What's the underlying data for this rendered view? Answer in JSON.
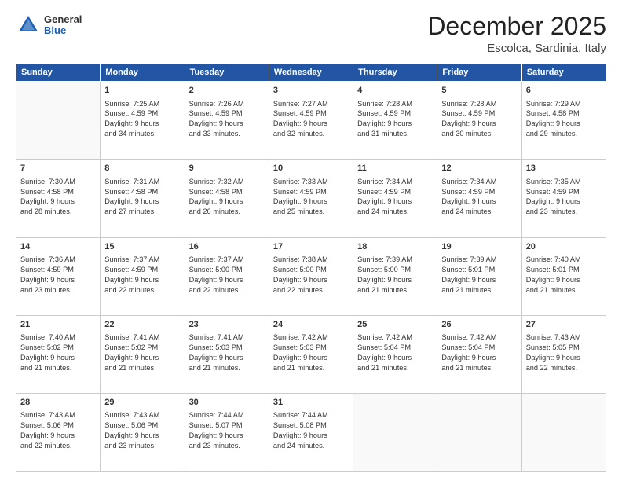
{
  "header": {
    "logo_general": "General",
    "logo_blue": "Blue",
    "month_title": "December 2025",
    "location": "Escolca, Sardinia, Italy"
  },
  "weekdays": [
    "Sunday",
    "Monday",
    "Tuesday",
    "Wednesday",
    "Thursday",
    "Friday",
    "Saturday"
  ],
  "weeks": [
    [
      {
        "day": "",
        "info": ""
      },
      {
        "day": "1",
        "info": "Sunrise: 7:25 AM\nSunset: 4:59 PM\nDaylight: 9 hours\nand 34 minutes."
      },
      {
        "day": "2",
        "info": "Sunrise: 7:26 AM\nSunset: 4:59 PM\nDaylight: 9 hours\nand 33 minutes."
      },
      {
        "day": "3",
        "info": "Sunrise: 7:27 AM\nSunset: 4:59 PM\nDaylight: 9 hours\nand 32 minutes."
      },
      {
        "day": "4",
        "info": "Sunrise: 7:28 AM\nSunset: 4:59 PM\nDaylight: 9 hours\nand 31 minutes."
      },
      {
        "day": "5",
        "info": "Sunrise: 7:28 AM\nSunset: 4:59 PM\nDaylight: 9 hours\nand 30 minutes."
      },
      {
        "day": "6",
        "info": "Sunrise: 7:29 AM\nSunset: 4:58 PM\nDaylight: 9 hours\nand 29 minutes."
      }
    ],
    [
      {
        "day": "7",
        "info": "Sunrise: 7:30 AM\nSunset: 4:58 PM\nDaylight: 9 hours\nand 28 minutes."
      },
      {
        "day": "8",
        "info": "Sunrise: 7:31 AM\nSunset: 4:58 PM\nDaylight: 9 hours\nand 27 minutes."
      },
      {
        "day": "9",
        "info": "Sunrise: 7:32 AM\nSunset: 4:58 PM\nDaylight: 9 hours\nand 26 minutes."
      },
      {
        "day": "10",
        "info": "Sunrise: 7:33 AM\nSunset: 4:59 PM\nDaylight: 9 hours\nand 25 minutes."
      },
      {
        "day": "11",
        "info": "Sunrise: 7:34 AM\nSunset: 4:59 PM\nDaylight: 9 hours\nand 24 minutes."
      },
      {
        "day": "12",
        "info": "Sunrise: 7:34 AM\nSunset: 4:59 PM\nDaylight: 9 hours\nand 24 minutes."
      },
      {
        "day": "13",
        "info": "Sunrise: 7:35 AM\nSunset: 4:59 PM\nDaylight: 9 hours\nand 23 minutes."
      }
    ],
    [
      {
        "day": "14",
        "info": "Sunrise: 7:36 AM\nSunset: 4:59 PM\nDaylight: 9 hours\nand 23 minutes."
      },
      {
        "day": "15",
        "info": "Sunrise: 7:37 AM\nSunset: 4:59 PM\nDaylight: 9 hours\nand 22 minutes."
      },
      {
        "day": "16",
        "info": "Sunrise: 7:37 AM\nSunset: 5:00 PM\nDaylight: 9 hours\nand 22 minutes."
      },
      {
        "day": "17",
        "info": "Sunrise: 7:38 AM\nSunset: 5:00 PM\nDaylight: 9 hours\nand 22 minutes."
      },
      {
        "day": "18",
        "info": "Sunrise: 7:39 AM\nSunset: 5:00 PM\nDaylight: 9 hours\nand 21 minutes."
      },
      {
        "day": "19",
        "info": "Sunrise: 7:39 AM\nSunset: 5:01 PM\nDaylight: 9 hours\nand 21 minutes."
      },
      {
        "day": "20",
        "info": "Sunrise: 7:40 AM\nSunset: 5:01 PM\nDaylight: 9 hours\nand 21 minutes."
      }
    ],
    [
      {
        "day": "21",
        "info": "Sunrise: 7:40 AM\nSunset: 5:02 PM\nDaylight: 9 hours\nand 21 minutes."
      },
      {
        "day": "22",
        "info": "Sunrise: 7:41 AM\nSunset: 5:02 PM\nDaylight: 9 hours\nand 21 minutes."
      },
      {
        "day": "23",
        "info": "Sunrise: 7:41 AM\nSunset: 5:03 PM\nDaylight: 9 hours\nand 21 minutes."
      },
      {
        "day": "24",
        "info": "Sunrise: 7:42 AM\nSunset: 5:03 PM\nDaylight: 9 hours\nand 21 minutes."
      },
      {
        "day": "25",
        "info": "Sunrise: 7:42 AM\nSunset: 5:04 PM\nDaylight: 9 hours\nand 21 minutes."
      },
      {
        "day": "26",
        "info": "Sunrise: 7:42 AM\nSunset: 5:04 PM\nDaylight: 9 hours\nand 21 minutes."
      },
      {
        "day": "27",
        "info": "Sunrise: 7:43 AM\nSunset: 5:05 PM\nDaylight: 9 hours\nand 22 minutes."
      }
    ],
    [
      {
        "day": "28",
        "info": "Sunrise: 7:43 AM\nSunset: 5:06 PM\nDaylight: 9 hours\nand 22 minutes."
      },
      {
        "day": "29",
        "info": "Sunrise: 7:43 AM\nSunset: 5:06 PM\nDaylight: 9 hours\nand 23 minutes."
      },
      {
        "day": "30",
        "info": "Sunrise: 7:44 AM\nSunset: 5:07 PM\nDaylight: 9 hours\nand 23 minutes."
      },
      {
        "day": "31",
        "info": "Sunrise: 7:44 AM\nSunset: 5:08 PM\nDaylight: 9 hours\nand 24 minutes."
      },
      {
        "day": "",
        "info": ""
      },
      {
        "day": "",
        "info": ""
      },
      {
        "day": "",
        "info": ""
      }
    ]
  ]
}
